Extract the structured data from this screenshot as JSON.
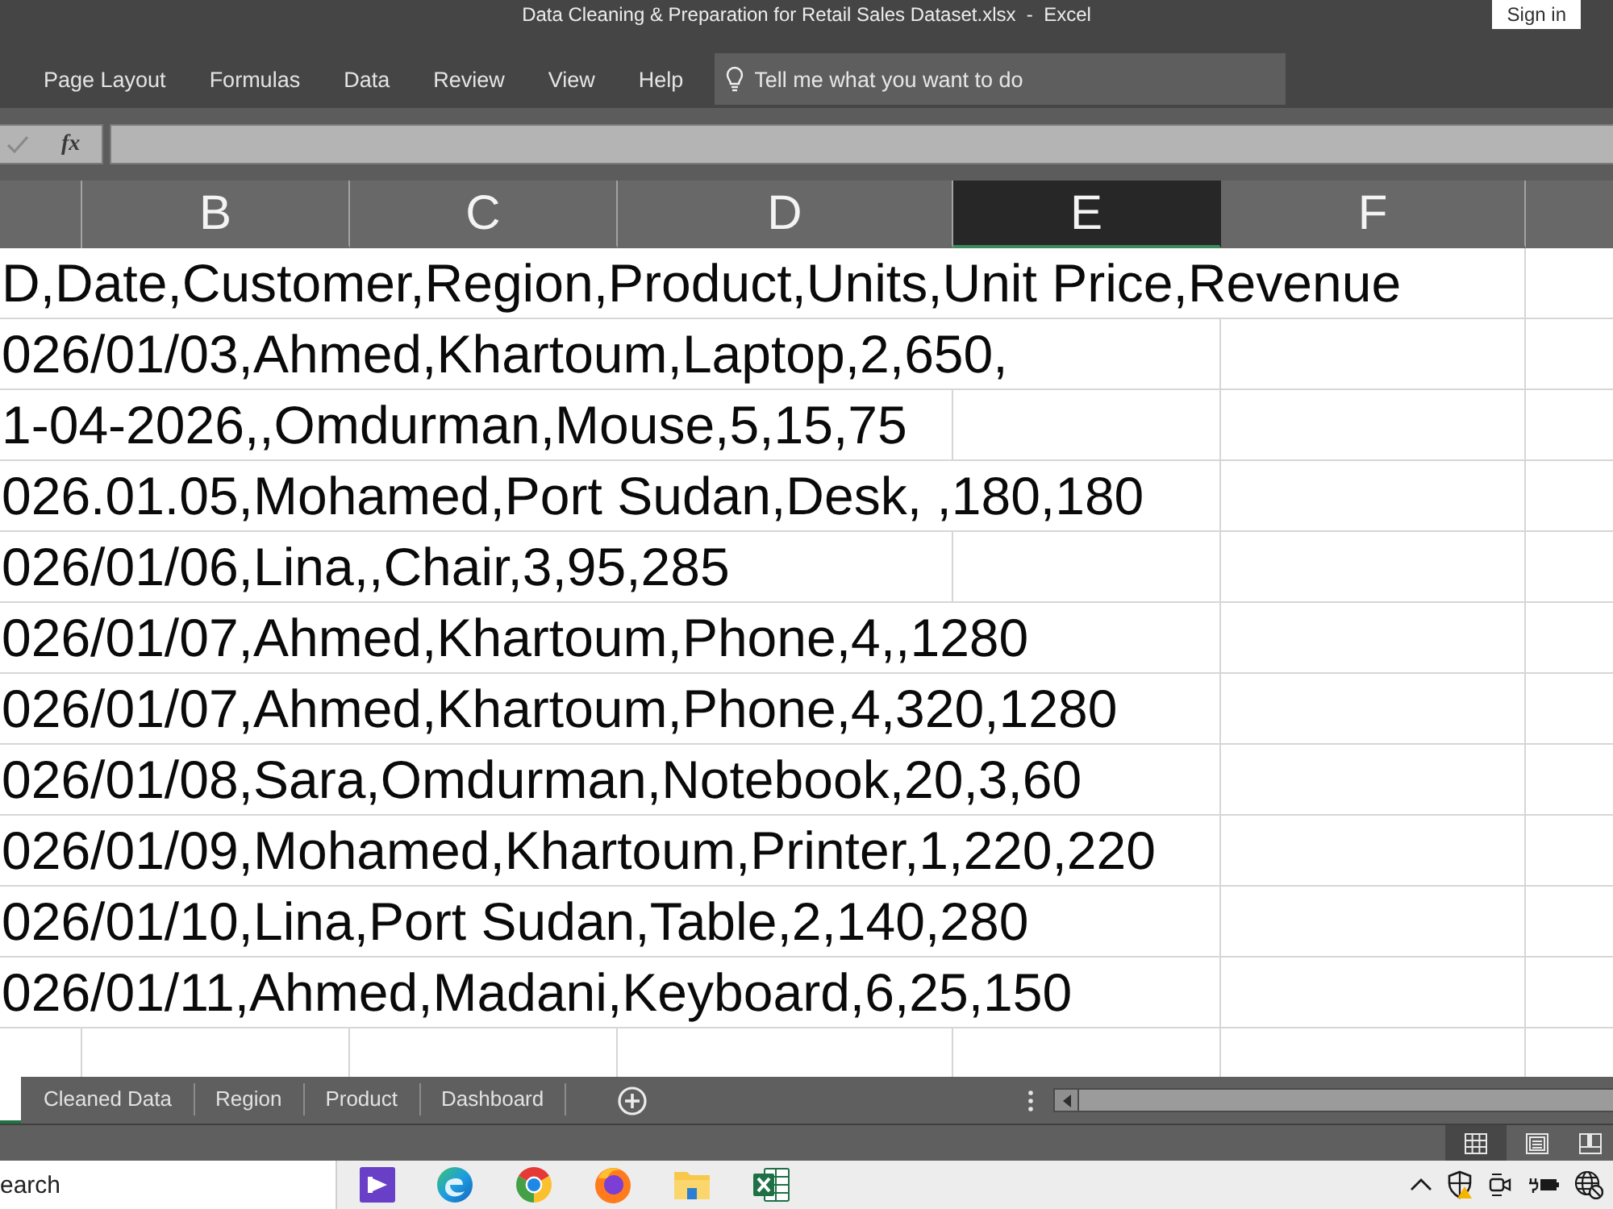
{
  "window": {
    "title": "Data Cleaning & Preparation for Retail Sales Dataset.xlsx  -  Excel",
    "sign_in": "Sign in"
  },
  "ribbon": {
    "tabs": [
      {
        "label": "Page Layout",
        "selected": false
      },
      {
        "label": "Formulas",
        "selected": false
      },
      {
        "label": "Data",
        "selected": false
      },
      {
        "label": "Review",
        "selected": false
      },
      {
        "label": "View",
        "selected": false
      },
      {
        "label": "Help",
        "selected": false
      }
    ],
    "search": {
      "placeholder": "Tell me what you want to do"
    }
  },
  "formula_bar": {
    "function_button": "fx"
  },
  "columns": [
    {
      "label": "B",
      "selected": false
    },
    {
      "label": "C",
      "selected": false
    },
    {
      "label": "D",
      "selected": false
    },
    {
      "label": "E",
      "selected": true
    },
    {
      "label": "F",
      "selected": false
    }
  ],
  "rows": [
    "D,Date,Customer,Region,Product,Units,Unit Price,Revenue",
    "026/01/03,Ahmed,Khartoum,Laptop,2,650,",
    "1-04-2026,,Omdurman,Mouse,5,15,75",
    "026.01.05,Mohamed,Port Sudan,Desk, ,180,180",
    "026/01/06,Lina,,Chair,3,95,285",
    "026/01/07,Ahmed,Khartoum,Phone,4,,1280",
    "026/01/07,Ahmed,Khartoum,Phone,4,320,1280",
    "026/01/08,Sara,Omdurman,Notebook,20,3,60",
    "026/01/09,Mohamed,Khartoum,Printer,1,220,220",
    "026/01/10,Lina,Port Sudan,Table,2,140,280",
    "026/01/11,Ahmed,Madani,Keyboard,6,25,150"
  ],
  "sheet_tabs": [
    {
      "selected": true
    },
    {
      "label": "Cleaned Data",
      "selected": false
    },
    {
      "label": "Region",
      "selected": false
    },
    {
      "label": "Product",
      "selected": false
    },
    {
      "label": "Dashboard",
      "selected": false
    }
  ],
  "status_bar": {
    "views": [
      {
        "kind": "normal",
        "selected": true
      },
      {
        "kind": "page_layout",
        "selected": false
      },
      {
        "kind": "page_break",
        "selected": false
      }
    ]
  },
  "taskbar": {
    "search": {
      "placeholder": "earch"
    }
  }
}
